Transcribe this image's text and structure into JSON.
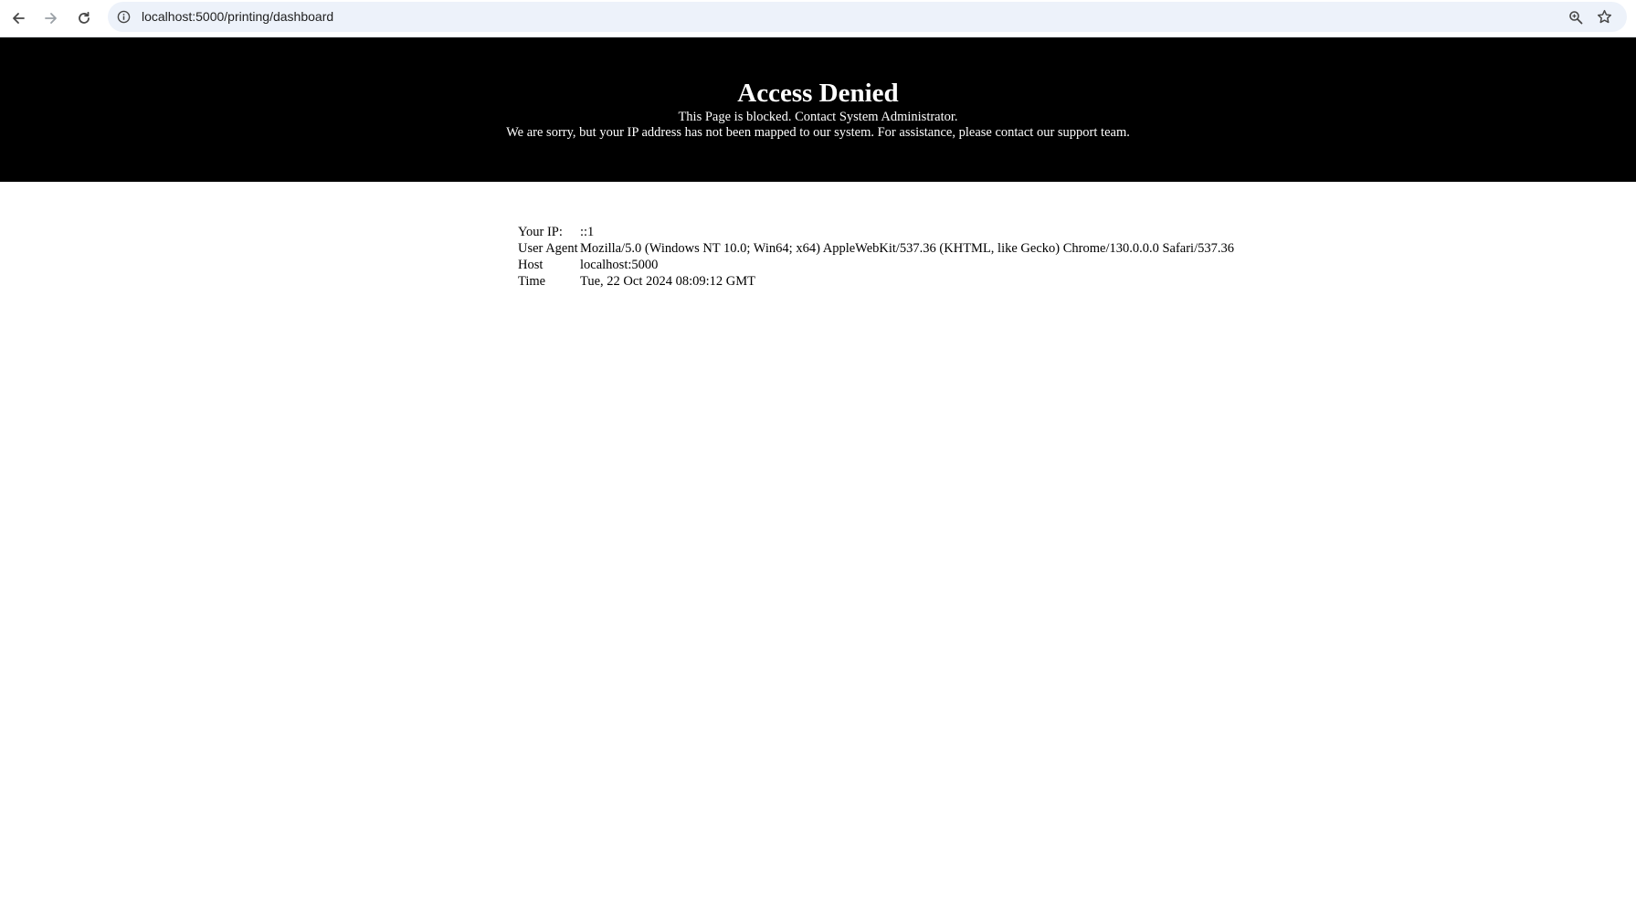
{
  "browser": {
    "url": "localhost:5000/printing/dashboard",
    "icons": {
      "back": "arrow-left-icon",
      "forward": "arrow-right-icon",
      "reload": "reload-icon",
      "site_info": "info-circle-icon",
      "zoom": "zoom-icon",
      "bookmark": "star-icon"
    }
  },
  "banner": {
    "title": "Access Denied",
    "line1": "This Page is blocked. Contact System Administrator.",
    "line2": "We are sorry, but your IP address has not been mapped to our system. For assistance, please contact our support team.",
    "background": "#000000",
    "text_color": "#ffffff"
  },
  "info": {
    "rows": [
      {
        "label": "Your IP:",
        "value": "::1"
      },
      {
        "label": "User Agent",
        "value": "Mozilla/5.0 (Windows NT 10.0; Win64; x64) AppleWebKit/537.36 (KHTML, like Gecko) Chrome/130.0.0.0 Safari/537.36"
      },
      {
        "label": "Host",
        "value": "localhost:5000"
      },
      {
        "label": "Time",
        "value": "Tue, 22 Oct 2024 08:09:12 GMT"
      }
    ]
  }
}
